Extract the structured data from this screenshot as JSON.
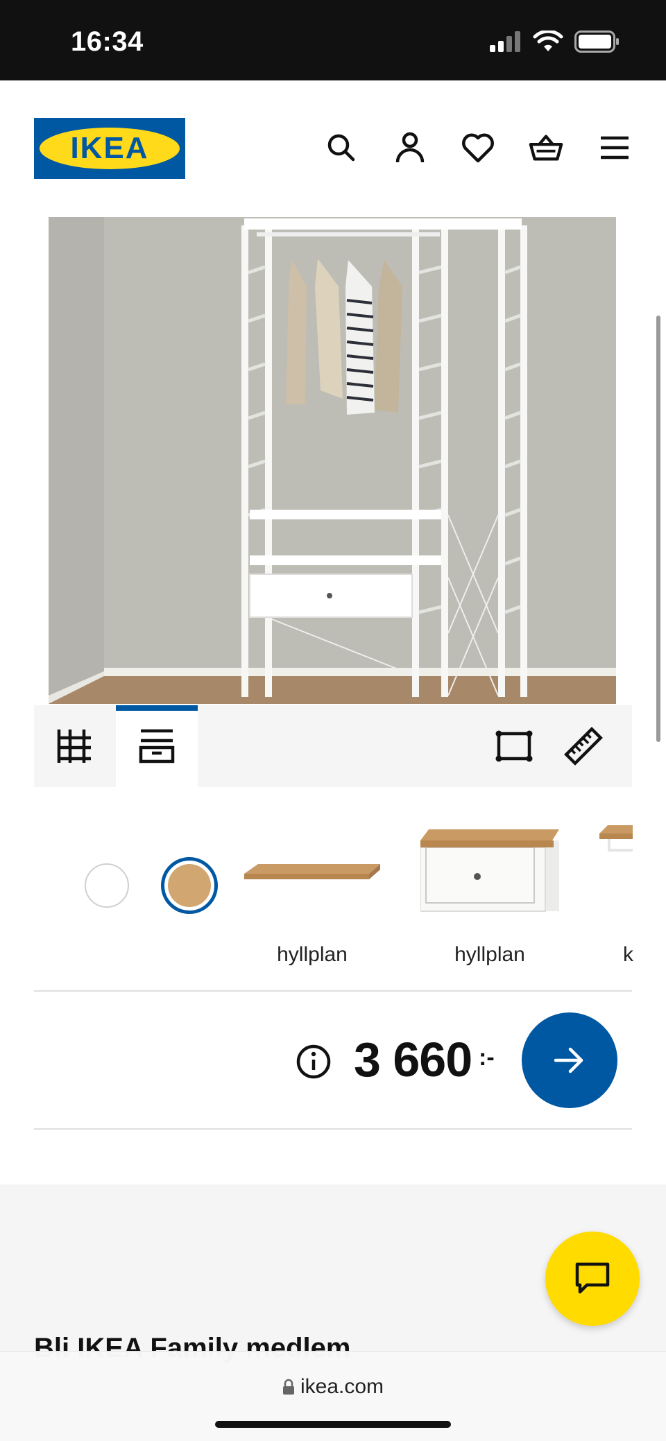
{
  "status_bar": {
    "time": "16:34"
  },
  "header": {
    "logo_text": "IKEA",
    "icons": [
      "search-icon",
      "account-icon",
      "heart-icon",
      "basket-icon",
      "menu-icon"
    ]
  },
  "toolbar": {
    "tabs": [
      "frame-view-icon",
      "shelf-drawer-view-icon"
    ],
    "active_tab": 1,
    "right_icons": [
      "frame-dimensions-icon",
      "ruler-icon"
    ]
  },
  "colors": {
    "brand_blue": "#0058a3",
    "brand_yellow": "#ffda1a",
    "selected_swatch": "oak"
  },
  "products": [
    {
      "label": "hyllplan"
    },
    {
      "label": "hyllplan"
    },
    {
      "label": "k"
    }
  ],
  "price": {
    "amount": "3 660",
    "suffix": ":-"
  },
  "footer": {
    "heading": "Bli IKEA Family medlem"
  },
  "browser": {
    "url": "ikea.com"
  }
}
